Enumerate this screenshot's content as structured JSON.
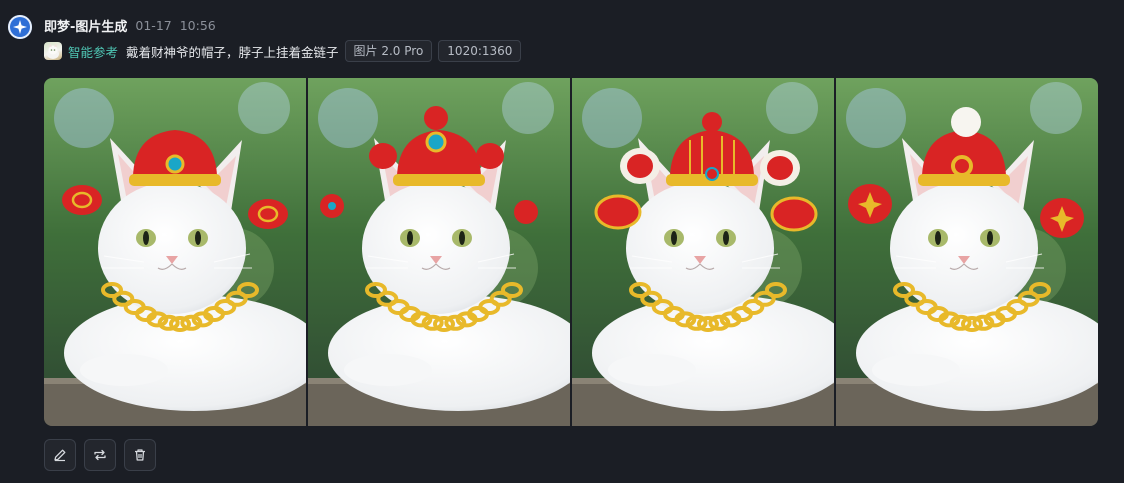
{
  "message": {
    "app_name": "即梦-图片生成",
    "date": "01-17",
    "time": "10:56"
  },
  "prompt": {
    "reference_label": "智能参考",
    "text": "戴着财神爷的帽子，脖子上挂着金链子",
    "model_tag": "图片 2.0 Pro",
    "size_tag": "1020:1360"
  },
  "images": [
    {
      "name": "image-1",
      "hat_decor": "coins"
    },
    {
      "name": "image-2",
      "hat_decor": "plain"
    },
    {
      "name": "image-3",
      "hat_decor": "stripes"
    },
    {
      "name": "image-4",
      "hat_decor": "pompom"
    }
  ],
  "toolbar": [
    {
      "name": "edit-button",
      "icon": "pencil-icon"
    },
    {
      "name": "regenerate-button",
      "icon": "repeat-icon"
    },
    {
      "name": "delete-button",
      "icon": "trash-icon"
    }
  ],
  "colors": {
    "accent": "#4fc7b5",
    "background": "#1b1e25",
    "hat_red": "#d92424",
    "gold": "#e8b92a"
  }
}
